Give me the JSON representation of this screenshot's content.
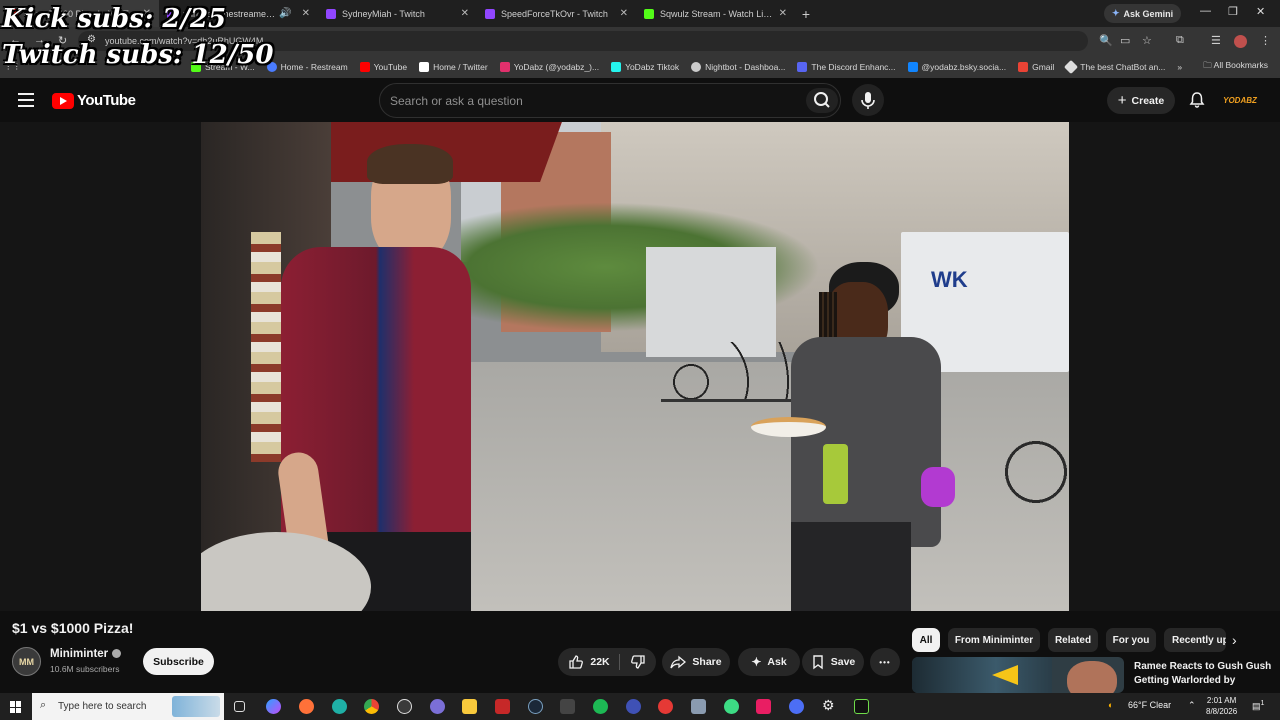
{
  "browser": {
    "tabs": [
      {
        "title": "$1 vs $1000 Pizza! - YouTube",
        "favicon_color": "#ff0000",
        "active": true
      },
      {
        "title": "princesssthestreamer - Twitch",
        "favicon_color": "#9146ff",
        "active": false
      },
      {
        "title": "SydneyMiah - Twitch",
        "favicon_color": "#9146ff",
        "active": false
      },
      {
        "title": "SpeedForceTkOvr - Twitch",
        "favicon_color": "#9146ff",
        "active": false
      },
      {
        "title": "Sqwulz Stream - Watch Live on",
        "favicon_color": "#53fc18",
        "active": false
      }
    ],
    "new_tab": "+",
    "ask_gemini": "Ask Gemini",
    "url": "youtube.com/watch?v=dh2uRhUGW4M",
    "bookmarks": [
      {
        "label": "Stream - W...",
        "color": "#53fc18"
      },
      {
        "label": "Home - Restream",
        "color": "#4a7cff"
      },
      {
        "label": "YouTube",
        "color": "#ff0000"
      },
      {
        "label": "Home / Twitter",
        "color": "#ffffff"
      },
      {
        "label": "YoDabz (@yodabz_)...",
        "color": "#e1306c"
      },
      {
        "label": "YoDabz Tiktok",
        "color": "#25f4ee"
      },
      {
        "label": "Nightbot - Dashboa...",
        "color": "#cccccc"
      },
      {
        "label": "The Discord Enhanc...",
        "color": "#5865f2"
      },
      {
        "label": "@yodabz.bsky.socia...",
        "color": "#1185fe"
      },
      {
        "label": "Gmail",
        "color": "#ea4335"
      },
      {
        "label": "The best ChatBot an...",
        "color": "#dddddd"
      }
    ],
    "bookmarks_more": "»",
    "all_bookmarks": "All Bookmarks"
  },
  "youtube": {
    "logo_text": "YouTube",
    "search_placeholder": "Search or ask a question",
    "create_label": "Create",
    "avatar_text": "YODABZ",
    "video": {
      "title": "$1 vs $1000 Pizza!",
      "channel": "Miniminter",
      "channel_avatar_text": "MM",
      "subscribers": "10.6M subscribers",
      "subscribe_label": "Subscribe",
      "likes": "22K",
      "share_label": "Share",
      "ask_label": "Ask",
      "save_label": "Save",
      "more_label": "•••"
    },
    "chips": [
      "All",
      "From Miniminter",
      "Related",
      "For you",
      "Recently uploaded"
    ],
    "chips_next": "›",
    "related_title": "Ramee Reacts to Gush Gush Getting Warlorded by"
  },
  "taskbar": {
    "search_placeholder": "Type here to search",
    "weather": "66°F  Clear",
    "time": "2:01 AM",
    "date": "8/8/2026",
    "notif_count": "1"
  },
  "overlay": {
    "kick_subs": "Kick subs: 2/25",
    "twitch_subs": "Twitch subs: 12/50"
  },
  "colors": {
    "yt_red": "#ff0000",
    "background": "#0f0f0f",
    "pill_bg": "#272727"
  }
}
